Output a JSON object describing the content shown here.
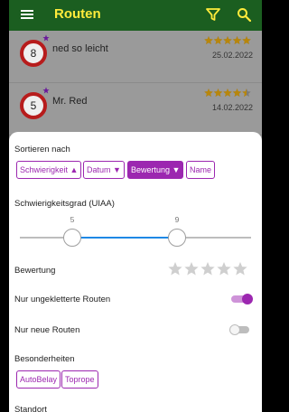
{
  "appbar": {
    "title": "Routen",
    "menu_icon": "menu-icon",
    "filter_icon": "filter-icon",
    "search_icon": "search-icon",
    "background": "#1b5e20",
    "title_color": "#ffeb3b"
  },
  "routes": [
    {
      "grade": "8",
      "name": "ned so leicht",
      "date": "25.02.2022",
      "rating": 5,
      "new": true
    },
    {
      "grade": "5",
      "name": "Mr. Red",
      "date": "14.02.2022",
      "rating": 4.5,
      "new": true
    }
  ],
  "sheet": {
    "sort_label": "Sortieren nach",
    "sort_options": [
      {
        "label": "Schwierigkeit ▲",
        "selected": false
      },
      {
        "label": "Datum ▼",
        "selected": false
      },
      {
        "label": "Bewertung ▼",
        "selected": true
      },
      {
        "label": "Name",
        "selected": false
      }
    ],
    "difficulty_label": "Schwierigkeitsgrad (UIAA)",
    "difficulty_min": "5",
    "difficulty_max": "9",
    "rating_label": "Bewertung",
    "rating_value": 0,
    "unclimbed_label": "Nur ungekletterte Routen",
    "unclimbed_on": true,
    "new_label": "Nur neue Routen",
    "new_on": false,
    "features_label": "Besonderheiten",
    "features": [
      "AutoBelay",
      "Toprope"
    ],
    "location_label": "Standort"
  },
  "colors": {
    "accent": "#9c27b0",
    "slider": "#1e88e5",
    "star": "#fbc02d",
    "grade_ring": "#b71c1c"
  }
}
